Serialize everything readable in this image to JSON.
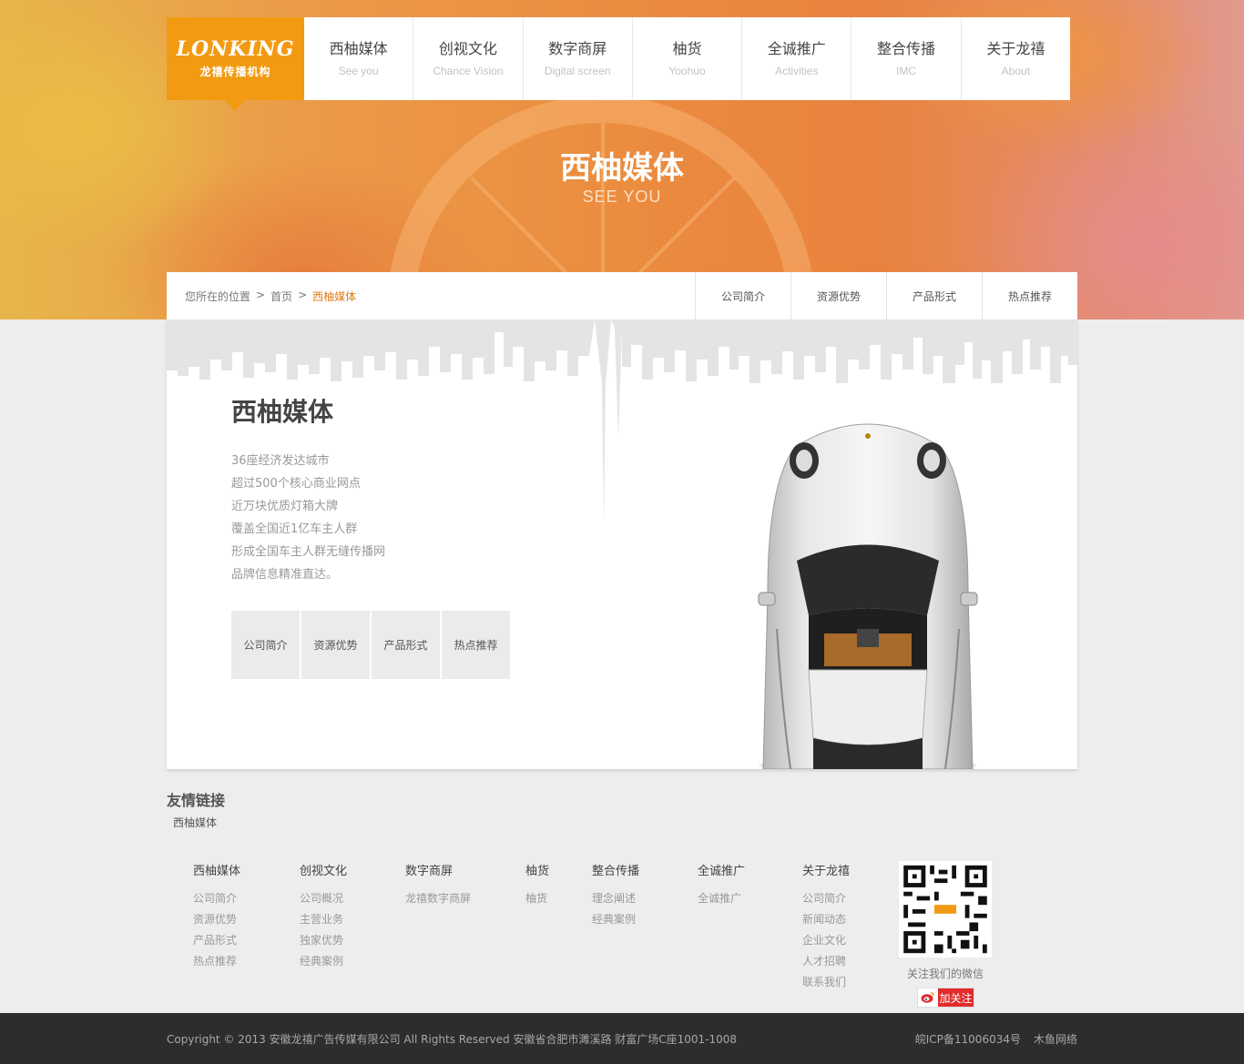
{
  "logo": {
    "mark": "LONKING",
    "subtitle": "龙禧传播机构"
  },
  "nav": [
    {
      "cn": "西柚媒体",
      "en": "See you"
    },
    {
      "cn": "创视文化",
      "en": "Chance Vision"
    },
    {
      "cn": "数字商屏",
      "en": "Digital screen"
    },
    {
      "cn": "柚货",
      "en": "Yoohuo"
    },
    {
      "cn": "全诚推广",
      "en": "Activities"
    },
    {
      "cn": "整合传播",
      "en": "IMC"
    },
    {
      "cn": "关于龙禧",
      "en": "About"
    }
  ],
  "hero": {
    "title": "西柚媒体",
    "subtitle": "SEE YOU"
  },
  "breadcrumb": {
    "prefix": "您所在的位置",
    "sep": ">",
    "home": "首页",
    "current": "西柚媒体"
  },
  "subnav": [
    "公司简介",
    "资源优势",
    "产品形式",
    "热点推荐"
  ],
  "main": {
    "title": "西柚媒体",
    "lines": [
      "36座经济发达城市",
      "超过500个核心商业网点",
      "近万块优质灯箱大牌",
      "覆盖全国近1亿车主人群",
      "形成全国车主人群无缝传播网",
      "品牌信息精准直达。"
    ],
    "tiles": [
      "公司简介",
      "资源优势",
      "产品形式",
      "热点推荐"
    ]
  },
  "friends": {
    "title": "友情链接",
    "links": [
      "西柚媒体"
    ]
  },
  "footer_cols": [
    {
      "title": "西柚媒体",
      "links": [
        "公司简介",
        "资源优势",
        "产品形式",
        "热点推荐"
      ]
    },
    {
      "title": "创视文化",
      "links": [
        "公司概况",
        "主营业务",
        "独家优势",
        "经典案例"
      ]
    },
    {
      "title": "数字商屏",
      "links": [
        "龙禧数字商屏"
      ]
    },
    {
      "title": "柚货",
      "links": [
        "柚货"
      ]
    },
    {
      "title": "整合传播",
      "links": [
        "理念阐述",
        "经典案例"
      ]
    },
    {
      "title": "全诚推广",
      "links": [
        "全诚推广"
      ]
    },
    {
      "title": "关于龙禧",
      "links": [
        "公司简介",
        "新闻动态",
        "企业文化",
        "人才招聘",
        "联系我们"
      ]
    }
  ],
  "qr": {
    "caption": "关注我们的微信",
    "icon": "qr-code-icon"
  },
  "weibo": {
    "label": "加关注",
    "icon": "weibo-icon"
  },
  "bottom": {
    "copyright": "Copyright © 2013 安徽龙禧广告传媒有限公司  All Rights Reserved  安徽省合肥市濉溪路  财富广场C座1001-1008",
    "icp": "皖ICP备11006034号",
    "credit": "木鱼网络"
  },
  "colors": {
    "accent": "#f29a12",
    "breadcrumb_current": "#e07b16",
    "footer_bg": "#2d2d2d",
    "weibo_red": "#e22b2b"
  }
}
